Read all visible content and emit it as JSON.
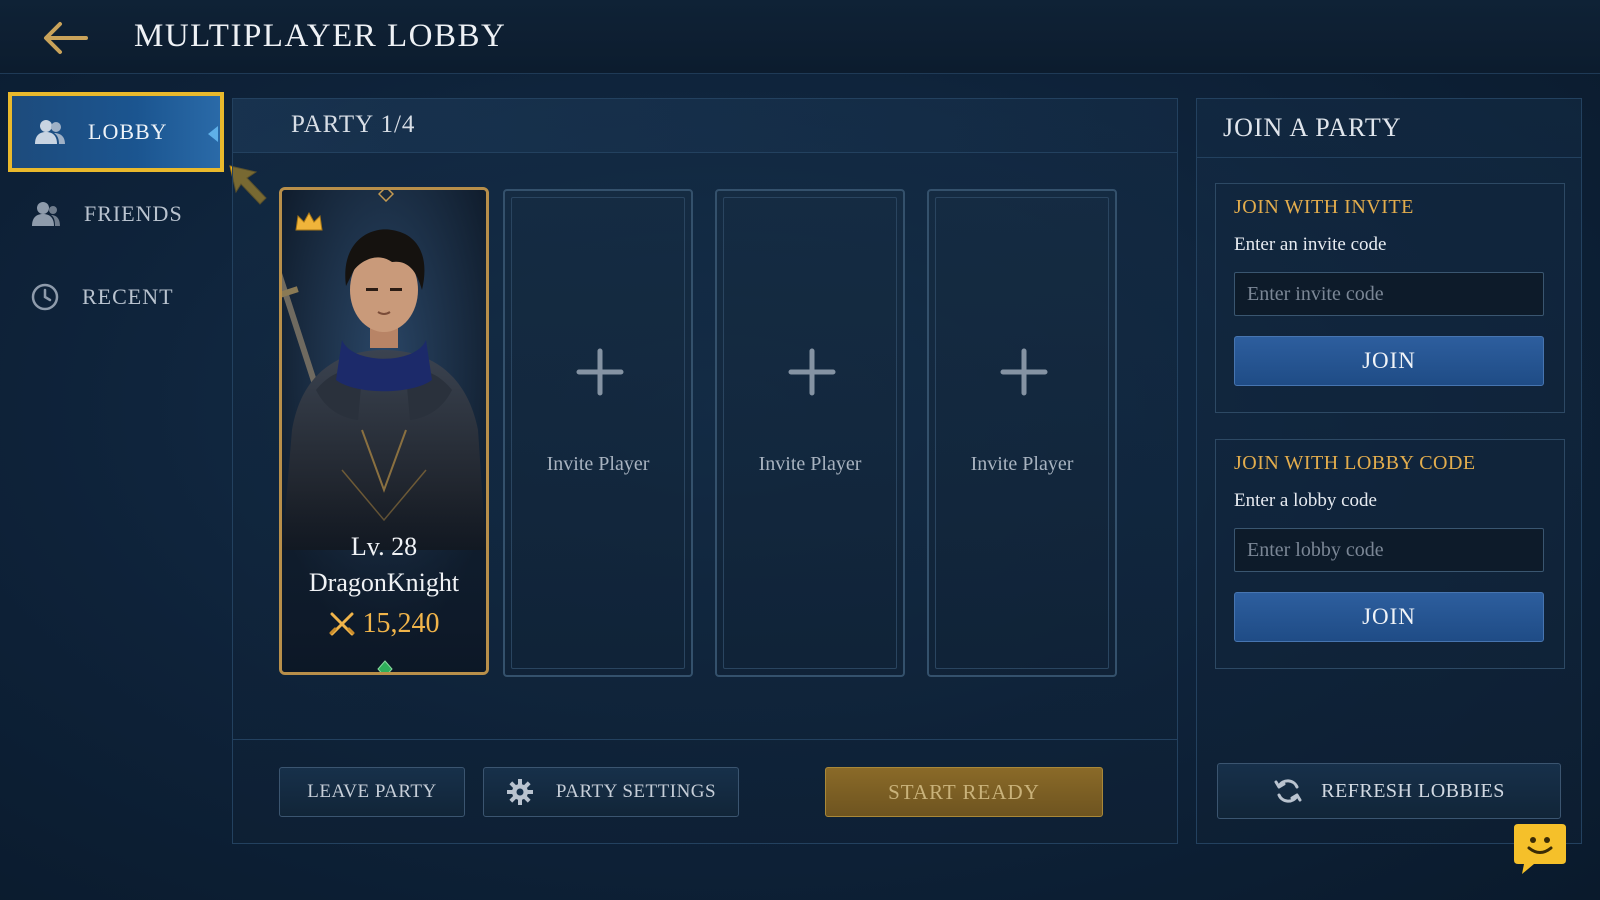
{
  "header": {
    "title": "MULTIPLAYER LOBBY"
  },
  "sidebar": {
    "items": [
      {
        "label": "LOBBY",
        "icon": "users-icon",
        "active": true
      },
      {
        "label": "FRIENDS",
        "icon": "user-icon",
        "active": false
      },
      {
        "label": "RECENT",
        "icon": "clock-icon",
        "active": false
      }
    ]
  },
  "party": {
    "title": "PARTY 1/4",
    "player": {
      "level": "Lv. 28",
      "name": "DragonKnight",
      "power": "15,240"
    },
    "empty_slots": [
      {
        "label": "Invite Player"
      },
      {
        "label": "Invite Player"
      },
      {
        "label": "Invite Player"
      }
    ],
    "buttons": {
      "leave": "LEAVE PARTY",
      "settings": "PARTY SETTINGS",
      "start": "START READY"
    }
  },
  "join": {
    "title": "JOIN A PARTY",
    "invite": {
      "title": "JOIN WITH INVITE",
      "description": "Enter an invite code",
      "placeholder": "Enter invite code",
      "button": "JOIN"
    },
    "lobby": {
      "title": "JOIN WITH LOBBY CODE",
      "description": "Enter a lobby code",
      "placeholder": "Enter lobby code",
      "button": "JOIN"
    },
    "refresh": "REFRESH LOBBIES"
  },
  "colors": {
    "accent_gold": "#e3ad4d",
    "highlight_yellow": "#e9b92c",
    "button_blue": "#2d5e9e"
  }
}
